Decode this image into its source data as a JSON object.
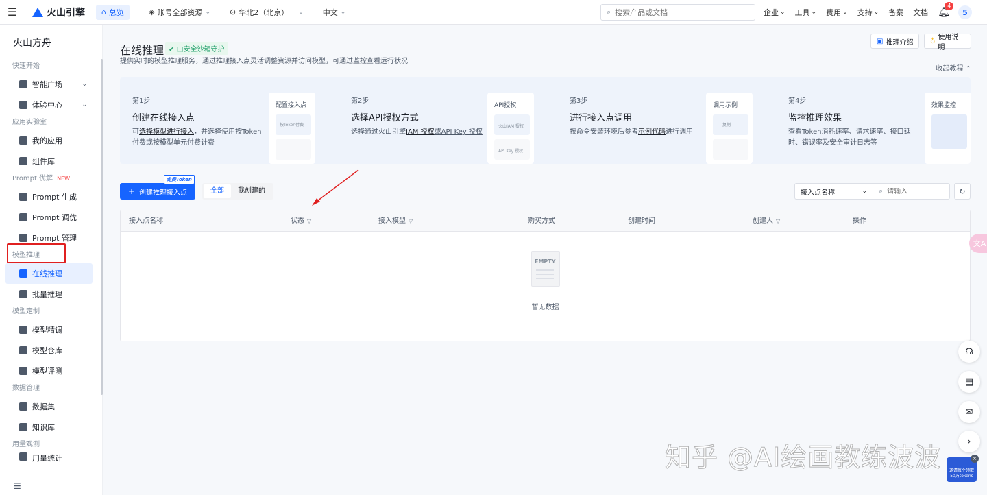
{
  "topbar": {
    "brand": "火山引擎",
    "home": "总览",
    "account": "账号全部资源",
    "region": "华北2（北京）",
    "language": "中文",
    "search_placeholder": "搜索产品或文档",
    "links": [
      "企业",
      "工具",
      "费用",
      "支持",
      "备案",
      "文档"
    ],
    "notification_count": "4",
    "avatar": "5"
  },
  "sidebar": {
    "title": "火山方舟",
    "groups": [
      {
        "label": "快速开始",
        "items": [
          {
            "label": "智能广场",
            "chevron": true
          },
          {
            "label": "体验中心",
            "chevron": true
          }
        ]
      },
      {
        "label": "应用实验室",
        "items": [
          {
            "label": "我的应用"
          },
          {
            "label": "组件库"
          }
        ]
      },
      {
        "label": "Prompt 优解",
        "badge": "NEW",
        "items": [
          {
            "label": "Prompt 生成"
          },
          {
            "label": "Prompt 调优"
          },
          {
            "label": "Prompt 管理"
          }
        ]
      },
      {
        "label": "模型推理",
        "items": [
          {
            "label": "在线推理",
            "active": true
          },
          {
            "label": "批量推理"
          }
        ]
      },
      {
        "label": "模型定制",
        "items": [
          {
            "label": "模型精调"
          },
          {
            "label": "模型仓库"
          },
          {
            "label": "模型评测"
          }
        ]
      },
      {
        "label": "数据管理",
        "items": [
          {
            "label": "数据集"
          },
          {
            "label": "知识库"
          }
        ]
      },
      {
        "label": "用量观测",
        "items": [
          {
            "label": "用量统计"
          }
        ]
      }
    ]
  },
  "page": {
    "title": "在线推理",
    "sandbox_badge": "由安全沙箱守护",
    "description": "提供实时的模型推理服务，通过推理接入点灵活调整资源并访问模型，可通过监控查看运行状况",
    "btn_intro": "推理介绍",
    "btn_guide": "使用说明",
    "collapse": "收起教程"
  },
  "steps": [
    {
      "no": "第1步",
      "title": "创建在线接入点",
      "desc_pre": "可",
      "desc_link": "选择模型进行接入",
      "desc_post": "，并选择使用按Token付费或按模型单元付费计费",
      "card": "配置接入点",
      "card_tag": "按Token付费"
    },
    {
      "no": "第2步",
      "title": "选择API授权方式",
      "desc_pre": "选择通过火山引擎",
      "desc_link": "IAM 授权",
      "desc_post": "或API Key 授权",
      "card": "API授权",
      "card_tag": "火山IAM 授权",
      "card_tag2": "API Key 授权"
    },
    {
      "no": "第3步",
      "title": "进行接入点调用",
      "desc_pre": "按命令安装环境后参考",
      "desc_link": "示例代码",
      "desc_post": "进行调用",
      "card": "调用示例",
      "card_tag": "复制"
    },
    {
      "no": "第4步",
      "title": "监控推理效果",
      "desc_pre": "查看Token消耗速率、请求速率、接口延时、错误率及安全审计日志等",
      "desc_link": "",
      "desc_post": "",
      "card": "效果监控",
      "card_tag": ""
    }
  ],
  "toolbar": {
    "create": "创建推理接入点",
    "token_tag": "免费Token",
    "tab_all": "全部",
    "tab_mine": "我创建的",
    "filter_field": "接入点名称",
    "filter_placeholder": "请输入"
  },
  "table": {
    "columns": [
      {
        "label": "接入点名称",
        "filter": false
      },
      {
        "label": "状态",
        "filter": true
      },
      {
        "label": "接入模型",
        "filter": true
      },
      {
        "label": "购买方式",
        "filter": false
      },
      {
        "label": "创建时间",
        "filter": false
      },
      {
        "label": "创建人",
        "filter": true
      },
      {
        "label": "操作",
        "filter": false
      }
    ],
    "empty_icon_text": "EMPTY",
    "empty_text": "暂无数据"
  },
  "watermark": "知乎 @AI绘画教练波波",
  "promo": "邀请每个领取 50万tokens",
  "colors": {
    "primary": "#1664ff",
    "highlight_box": "#e02020",
    "sandbox": "#2ba471"
  }
}
